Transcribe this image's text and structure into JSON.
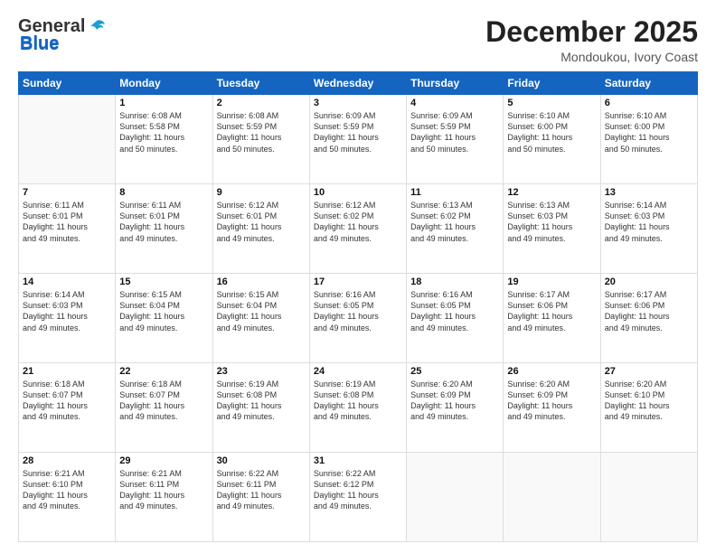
{
  "header": {
    "logo_general": "General",
    "logo_blue": "Blue",
    "month": "December 2025",
    "location": "Mondoukou, Ivory Coast"
  },
  "days_of_week": [
    "Sunday",
    "Monday",
    "Tuesday",
    "Wednesday",
    "Thursday",
    "Friday",
    "Saturday"
  ],
  "weeks": [
    [
      {
        "day": "",
        "info": ""
      },
      {
        "day": "1",
        "info": "Sunrise: 6:08 AM\nSunset: 5:58 PM\nDaylight: 11 hours\nand 50 minutes."
      },
      {
        "day": "2",
        "info": "Sunrise: 6:08 AM\nSunset: 5:59 PM\nDaylight: 11 hours\nand 50 minutes."
      },
      {
        "day": "3",
        "info": "Sunrise: 6:09 AM\nSunset: 5:59 PM\nDaylight: 11 hours\nand 50 minutes."
      },
      {
        "day": "4",
        "info": "Sunrise: 6:09 AM\nSunset: 5:59 PM\nDaylight: 11 hours\nand 50 minutes."
      },
      {
        "day": "5",
        "info": "Sunrise: 6:10 AM\nSunset: 6:00 PM\nDaylight: 11 hours\nand 50 minutes."
      },
      {
        "day": "6",
        "info": "Sunrise: 6:10 AM\nSunset: 6:00 PM\nDaylight: 11 hours\nand 50 minutes."
      }
    ],
    [
      {
        "day": "7",
        "info": "Sunrise: 6:11 AM\nSunset: 6:01 PM\nDaylight: 11 hours\nand 49 minutes."
      },
      {
        "day": "8",
        "info": "Sunrise: 6:11 AM\nSunset: 6:01 PM\nDaylight: 11 hours\nand 49 minutes."
      },
      {
        "day": "9",
        "info": "Sunrise: 6:12 AM\nSunset: 6:01 PM\nDaylight: 11 hours\nand 49 minutes."
      },
      {
        "day": "10",
        "info": "Sunrise: 6:12 AM\nSunset: 6:02 PM\nDaylight: 11 hours\nand 49 minutes."
      },
      {
        "day": "11",
        "info": "Sunrise: 6:13 AM\nSunset: 6:02 PM\nDaylight: 11 hours\nand 49 minutes."
      },
      {
        "day": "12",
        "info": "Sunrise: 6:13 AM\nSunset: 6:03 PM\nDaylight: 11 hours\nand 49 minutes."
      },
      {
        "day": "13",
        "info": "Sunrise: 6:14 AM\nSunset: 6:03 PM\nDaylight: 11 hours\nand 49 minutes."
      }
    ],
    [
      {
        "day": "14",
        "info": "Sunrise: 6:14 AM\nSunset: 6:03 PM\nDaylight: 11 hours\nand 49 minutes."
      },
      {
        "day": "15",
        "info": "Sunrise: 6:15 AM\nSunset: 6:04 PM\nDaylight: 11 hours\nand 49 minutes."
      },
      {
        "day": "16",
        "info": "Sunrise: 6:15 AM\nSunset: 6:04 PM\nDaylight: 11 hours\nand 49 minutes."
      },
      {
        "day": "17",
        "info": "Sunrise: 6:16 AM\nSunset: 6:05 PM\nDaylight: 11 hours\nand 49 minutes."
      },
      {
        "day": "18",
        "info": "Sunrise: 6:16 AM\nSunset: 6:05 PM\nDaylight: 11 hours\nand 49 minutes."
      },
      {
        "day": "19",
        "info": "Sunrise: 6:17 AM\nSunset: 6:06 PM\nDaylight: 11 hours\nand 49 minutes."
      },
      {
        "day": "20",
        "info": "Sunrise: 6:17 AM\nSunset: 6:06 PM\nDaylight: 11 hours\nand 49 minutes."
      }
    ],
    [
      {
        "day": "21",
        "info": "Sunrise: 6:18 AM\nSunset: 6:07 PM\nDaylight: 11 hours\nand 49 minutes."
      },
      {
        "day": "22",
        "info": "Sunrise: 6:18 AM\nSunset: 6:07 PM\nDaylight: 11 hours\nand 49 minutes."
      },
      {
        "day": "23",
        "info": "Sunrise: 6:19 AM\nSunset: 6:08 PM\nDaylight: 11 hours\nand 49 minutes."
      },
      {
        "day": "24",
        "info": "Sunrise: 6:19 AM\nSunset: 6:08 PM\nDaylight: 11 hours\nand 49 minutes."
      },
      {
        "day": "25",
        "info": "Sunrise: 6:20 AM\nSunset: 6:09 PM\nDaylight: 11 hours\nand 49 minutes."
      },
      {
        "day": "26",
        "info": "Sunrise: 6:20 AM\nSunset: 6:09 PM\nDaylight: 11 hours\nand 49 minutes."
      },
      {
        "day": "27",
        "info": "Sunrise: 6:20 AM\nSunset: 6:10 PM\nDaylight: 11 hours\nand 49 minutes."
      }
    ],
    [
      {
        "day": "28",
        "info": "Sunrise: 6:21 AM\nSunset: 6:10 PM\nDaylight: 11 hours\nand 49 minutes."
      },
      {
        "day": "29",
        "info": "Sunrise: 6:21 AM\nSunset: 6:11 PM\nDaylight: 11 hours\nand 49 minutes."
      },
      {
        "day": "30",
        "info": "Sunrise: 6:22 AM\nSunset: 6:11 PM\nDaylight: 11 hours\nand 49 minutes."
      },
      {
        "day": "31",
        "info": "Sunrise: 6:22 AM\nSunset: 6:12 PM\nDaylight: 11 hours\nand 49 minutes."
      },
      {
        "day": "",
        "info": ""
      },
      {
        "day": "",
        "info": ""
      },
      {
        "day": "",
        "info": ""
      }
    ]
  ]
}
